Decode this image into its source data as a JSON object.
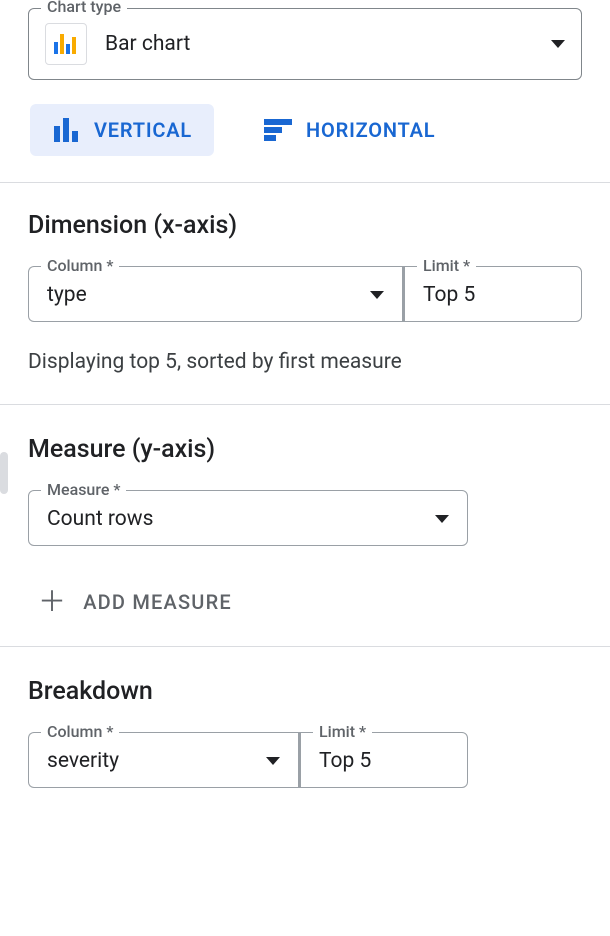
{
  "chartType": {
    "legend": "Chart type",
    "value": "Bar chart"
  },
  "orientation": {
    "vertical": "VERTICAL",
    "horizontal": "HORIZONTAL"
  },
  "dimension": {
    "heading": "Dimension (x-axis)",
    "columnLabel": "Column *",
    "columnValue": "type",
    "limitLabel": "Limit *",
    "limitValue": "Top 5",
    "hint": "Displaying top 5, sorted by first measure"
  },
  "measure": {
    "heading": "Measure (y-axis)",
    "measureLabel": "Measure *",
    "measureValue": "Count rows",
    "addMeasure": "ADD MEASURE"
  },
  "breakdown": {
    "heading": "Breakdown",
    "columnLabel": "Column *",
    "columnValue": "severity",
    "limitLabel": "Limit *",
    "limitValue": "Top 5"
  },
  "colors": {
    "blue": "#1a73e8",
    "orange": "#f9ab00"
  }
}
